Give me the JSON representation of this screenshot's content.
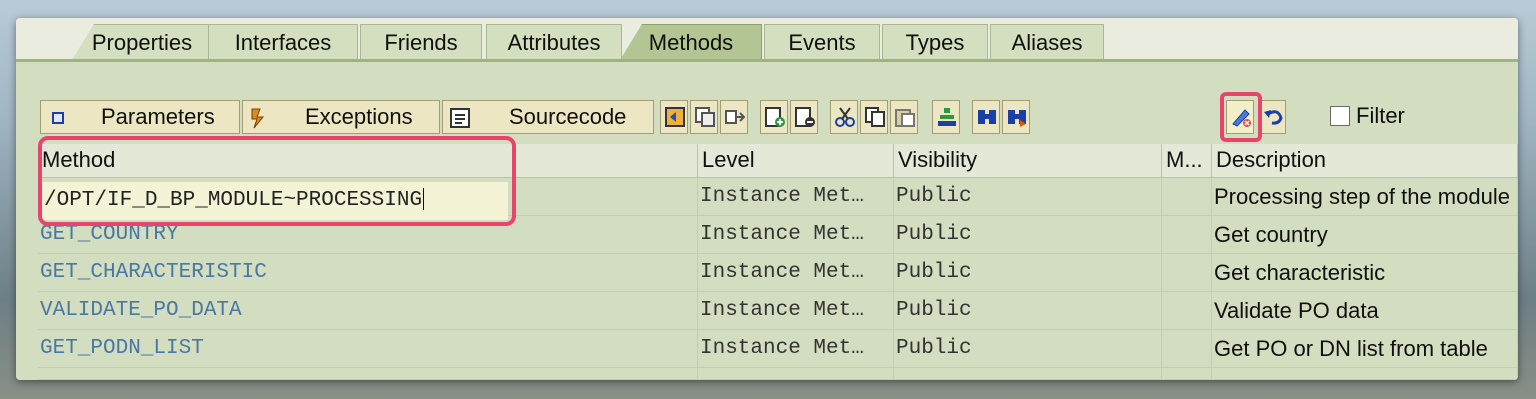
{
  "tabs": [
    {
      "label": "Properties",
      "active": false
    },
    {
      "label": "Interfaces",
      "active": false
    },
    {
      "label": "Friends",
      "active": false
    },
    {
      "label": "Attributes",
      "active": false
    },
    {
      "label": "Methods",
      "active": true
    },
    {
      "label": "Events",
      "active": false
    },
    {
      "label": "Types",
      "active": false
    },
    {
      "label": "Aliases",
      "active": false
    }
  ],
  "toolbar": {
    "parameters_label": "Parameters",
    "exceptions_label": "Exceptions",
    "sourcecode_label": "Sourcecode",
    "filter_label": "Filter",
    "filter_checked": false,
    "icons": [
      "navigate-icon",
      "copy-detail-icon",
      "redirect-icon",
      "insert-row-icon",
      "delete-row-icon",
      "cut-icon",
      "copy-icon",
      "paste-icon",
      "hierarchy-icon",
      "find-icon",
      "find-next-icon",
      "change-method-icon",
      "undo-icon"
    ]
  },
  "table": {
    "columns": [
      "Method",
      "Level",
      "Visibility",
      "M...",
      "Description"
    ],
    "editing_value": "/OPT/IF_D_BP_MODULE~PROCESSING",
    "rows": [
      {
        "method": "/OPT/IF_D_BP_MODULE~PROCESSING",
        "level": "Instance Met…",
        "visibility": "Public",
        "m": "",
        "description": "Processing step of the module"
      },
      {
        "method": "GET_COUNTRY",
        "level": "Instance Met…",
        "visibility": "Public",
        "m": "",
        "description": "Get country"
      },
      {
        "method": "GET_CHARACTERISTIC",
        "level": "Instance Met…",
        "visibility": "Public",
        "m": "",
        "description": "Get characteristic"
      },
      {
        "method": "VALIDATE_PO_DATA",
        "level": "Instance Met…",
        "visibility": "Public",
        "m": "",
        "description": "Validate PO data"
      },
      {
        "method": "GET_PODN_LIST",
        "level": "Instance Met…",
        "visibility": "Public",
        "m": "",
        "description": "Get PO or DN list from table"
      }
    ]
  },
  "colors": {
    "highlight": "#e8456d",
    "active_tab": "#b2c593",
    "link": "#4a78a3"
  }
}
